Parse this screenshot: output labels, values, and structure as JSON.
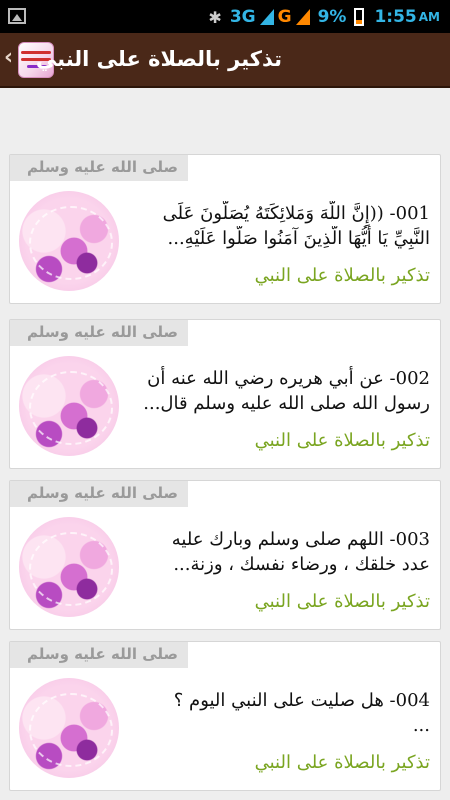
{
  "statusbar": {
    "network1": "3G",
    "network2": "G",
    "battery_percent": "9%",
    "time": "1:55",
    "time_suffix": "AM"
  },
  "actionbar": {
    "back": "‹",
    "title": "تذكير بالصلاة على النبي"
  },
  "items": [
    {
      "tag": "صلى الله عليه وسلم",
      "line1": "001- ((إِنَّ اللَّهَ وَمَلائِكَتَهُ يُصَلُّونَ عَلَى",
      "line2": "النَّبِيِّ يَا أَيُّهَا الَّذِينَ آمَنُوا صَلُّوا عَلَيْهِ...",
      "subtitle": "تذكير بالصلاة على النبي"
    },
    {
      "tag": "صلى الله عليه وسلم",
      "line1": "002- عن أبي هريره رضي الله عنه أن",
      "line2": "رسول الله صلى الله عليه وسلم قال...",
      "subtitle": "تذكير بالصلاة على النبي"
    },
    {
      "tag": "صلى الله عليه وسلم",
      "line1": "003- اللهم صلى وسلم وبارك عليه",
      "line2": "عدد خلقك ، ورضاء نفسك ، وزنة...",
      "subtitle": "تذكير بالصلاة على النبي"
    },
    {
      "tag": "صلى الله عليه وسلم",
      "line1": "004- هل صليت على النبي اليوم ؟",
      "line2": "...",
      "subtitle": "تذكير بالصلاة على النبي"
    }
  ]
}
